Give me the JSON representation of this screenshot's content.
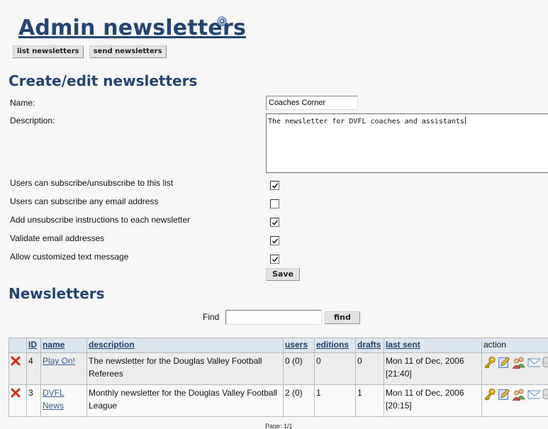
{
  "header": {
    "title": "Admin newsletters",
    "help_icon": "help-icon",
    "buttons": {
      "list": "list newsletters",
      "send": "send newsletters"
    }
  },
  "form": {
    "title": "Create/edit newsletters",
    "name_label": "Name:",
    "name_value": "Coaches Corner",
    "description_label": "Description:",
    "description_value": "The newsletter for DVFL coaches and assistants",
    "checkboxes": [
      {
        "label": "Users can subscribe/unsubscribe to this list",
        "checked": true
      },
      {
        "label": "Users can subscribe any email address",
        "checked": false
      },
      {
        "label": "Add unsubscribe instructions to each newsletter",
        "checked": true
      },
      {
        "label": "Validate email addresses",
        "checked": true
      },
      {
        "label": "Allow customized text message",
        "checked": true
      }
    ],
    "save_label": "Save"
  },
  "list": {
    "title": "Newsletters",
    "find_label": "Find",
    "find_value": "",
    "find_button": "find",
    "columns": {
      "id": "ID",
      "name": "name",
      "description": "description",
      "users": "users",
      "editions": "editions",
      "drafts": "drafts",
      "last_sent": "last sent",
      "action": "action"
    },
    "rows": [
      {
        "id": "4",
        "name": "Play On!",
        "description": "The newsletter for the Douglas Valley Football Referees",
        "users": "0 (0)",
        "editions": "0",
        "drafts": "0",
        "last_sent": "Mon 11 of Dec, 2006 [21:40]"
      },
      {
        "id": "3",
        "name": "DVFL News",
        "description": "Monthly newsletter for the Douglas Valley Football League",
        "users": "2 (0)",
        "editions": "1",
        "drafts": "1",
        "last_sent": "Mon 11 of Dec, 2006 [20:15]"
      }
    ],
    "pager": "Page: 1/1"
  },
  "icons": {
    "delete": "delete-icon",
    "key": "key-icon",
    "edit": "edit-icon",
    "users": "users-icon",
    "send": "envelope-icon",
    "archive": "database-icon"
  },
  "colors": {
    "heading": "#23456f",
    "table_header": "#dde6ee",
    "delete": "#d42c1c"
  }
}
